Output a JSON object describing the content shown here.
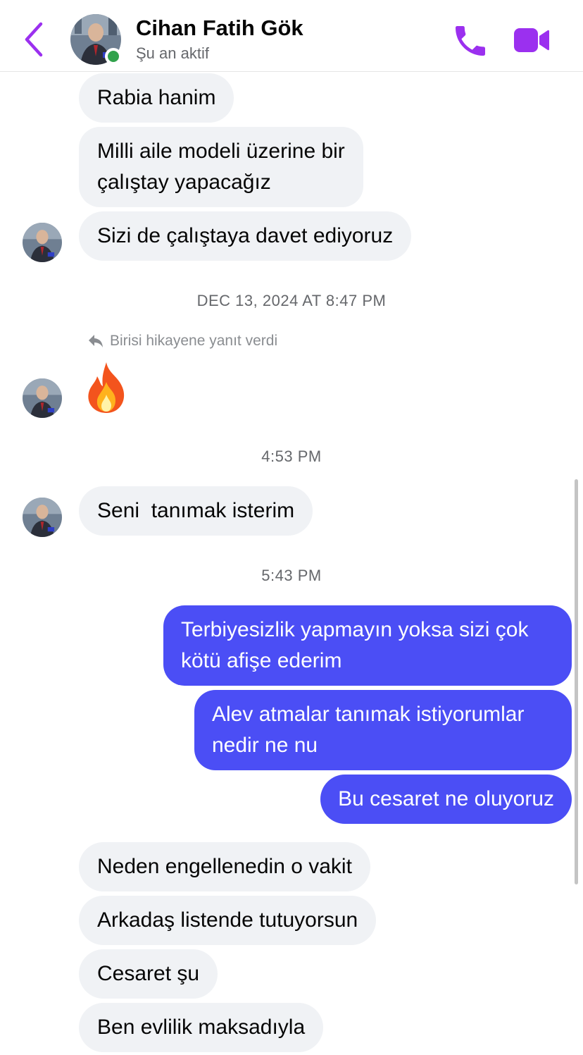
{
  "header": {
    "contact_name": "Cihan Fatih Gök",
    "status": "Şu an aktif",
    "accent_color": "#9b30ef"
  },
  "icons": {
    "back": "chevron-left-icon",
    "call": "phone-icon",
    "video": "video-camera-icon",
    "reply": "reply-arrow-icon"
  },
  "messages": {
    "m1": "Rabia hanim",
    "m2_line1": "Milli aile modeli üzerine bir",
    "m2_line2": "çalıştay yapacağız",
    "m3": "Sizi de çalıştaya davet ediyoruz",
    "ts1": "DEC 13, 2024 AT 8:47 PM",
    "story_reply": "Birisi hikayene yanıt verdi",
    "reaction_emoji": "🔥",
    "ts2": "4:53 PM",
    "m4": "Seni  tanımak isterim",
    "ts3": "5:43 PM",
    "o1_line1": "Terbiyesizlik yapmayın yoksa sizi çok",
    "o1_line2": "kötü afişe ederim",
    "o2_line1": "Alev atmalar tanımak istiyorumlar",
    "o2_line2": "nedir ne nu",
    "o3": "Bu cesaret ne oluyoruz",
    "m5": "Neden engellenedin o vakit",
    "m6": "Arkadaş listende tutuyorsun",
    "m7": "Cesaret şu",
    "m8": "Ben evlilik maksadıyla"
  },
  "colors": {
    "outgoing_bubble": "#4b4ef5",
    "incoming_bubble": "#f0f2f5",
    "online": "#31a24c"
  }
}
